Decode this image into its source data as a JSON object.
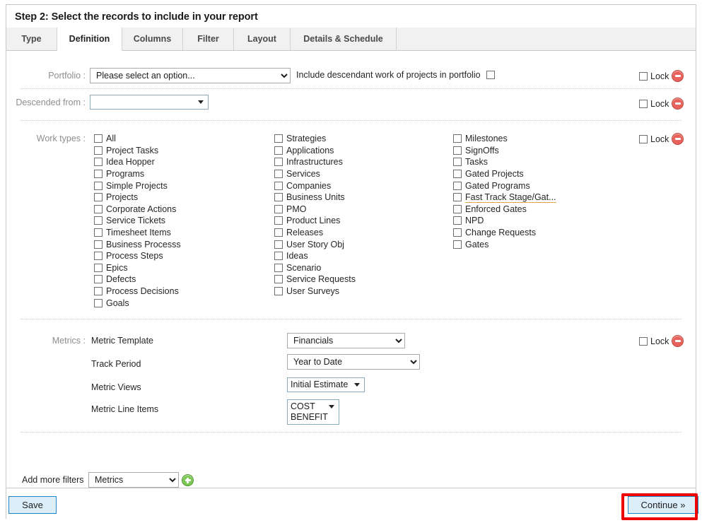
{
  "window": {
    "title": "Step 2: Select the records to include in your report"
  },
  "tabs": [
    {
      "label": "Type",
      "active": false
    },
    {
      "label": "Definition",
      "active": true
    },
    {
      "label": "Columns",
      "active": false
    },
    {
      "label": "Filter",
      "active": false
    },
    {
      "label": "Layout",
      "active": false
    },
    {
      "label": "Details & Schedule",
      "active": false
    }
  ],
  "portfolio": {
    "label": "Portfolio :",
    "select_value": "Please select an option...",
    "options": [
      "Please select an option..."
    ],
    "include_descendant_label": "Include descendant work of projects in portfolio",
    "include_descendant_checked": false,
    "lock_label": "Lock",
    "lock_checked": false,
    "remove_icon": "remove-circle-icon"
  },
  "descended_from": {
    "label": "Descended from :",
    "value": "",
    "lock_label": "Lock",
    "lock_checked": false,
    "remove_icon": "remove-circle-icon"
  },
  "work_types": {
    "label": "Work types :",
    "lock_label": "Lock",
    "lock_checked": false,
    "remove_icon": "remove-circle-icon",
    "columns": [
      {
        "items": [
          {
            "label": "All",
            "checked": false
          },
          {
            "label": "Project Tasks",
            "checked": false
          },
          {
            "label": "Idea Hopper",
            "checked": false
          },
          {
            "label": "Programs",
            "checked": false
          },
          {
            "label": "Simple Projects",
            "checked": false
          },
          {
            "label": "Projects",
            "checked": false
          },
          {
            "label": "Corporate Actions",
            "checked": false
          },
          {
            "label": "Service Tickets",
            "checked": false
          },
          {
            "label": "Timesheet Items",
            "checked": false
          },
          {
            "label": "Business Processs",
            "checked": false
          },
          {
            "label": "Process Steps",
            "checked": false
          },
          {
            "label": "Epics",
            "checked": false
          },
          {
            "label": "Defects",
            "checked": false
          },
          {
            "label": "Process Decisions",
            "checked": false
          },
          {
            "label": "Goals",
            "checked": false
          }
        ]
      },
      {
        "items": [
          {
            "label": "Strategies",
            "checked": false
          },
          {
            "label": "Applications",
            "checked": false
          },
          {
            "label": "Infrastructures",
            "checked": false
          },
          {
            "label": "Services",
            "checked": false
          },
          {
            "label": "Companies",
            "checked": false
          },
          {
            "label": "Business Units",
            "checked": false
          },
          {
            "label": "PMO",
            "checked": false
          },
          {
            "label": "Product Lines",
            "checked": false
          },
          {
            "label": "Releases",
            "checked": false
          },
          {
            "label": "User Story Obj",
            "checked": false
          },
          {
            "label": "Ideas",
            "checked": false
          },
          {
            "label": "Scenario",
            "checked": false
          },
          {
            "label": "Service Requests",
            "checked": false
          },
          {
            "label": "User Surveys",
            "checked": false
          }
        ]
      },
      {
        "items": [
          {
            "label": "Milestones",
            "checked": false
          },
          {
            "label": "SignOffs",
            "checked": false
          },
          {
            "label": "Tasks",
            "checked": false
          },
          {
            "label": "Gated Projects",
            "checked": false
          },
          {
            "label": "Gated Programs",
            "checked": false
          },
          {
            "label": "Fast Track Stage/Gat...",
            "checked": false,
            "truncated": true
          },
          {
            "label": "Enforced Gates",
            "checked": false
          },
          {
            "label": "NPD",
            "checked": false
          },
          {
            "label": "Change Requests",
            "checked": false
          },
          {
            "label": "Gates",
            "checked": false
          }
        ]
      }
    ]
  },
  "metrics": {
    "label": "Metrics :",
    "lock_label": "Lock",
    "lock_checked": false,
    "remove_icon": "remove-circle-icon",
    "rows": [
      {
        "label": "Metric Template",
        "value": "Financials",
        "control": "select"
      },
      {
        "label": "Track Period",
        "value": "Year to Date",
        "control": "select"
      },
      {
        "label": "Metric Views",
        "value": "Initial Estimate",
        "control": "combo"
      },
      {
        "label": "Metric Line Items",
        "value": "COST\nBENEFIT",
        "control": "combo-multi"
      }
    ],
    "metric_template_options": [
      "Financials"
    ],
    "track_period_options": [
      "Year to Date"
    ]
  },
  "add_filters": {
    "label": "Add more filters",
    "select_value": "Metrics",
    "options": [
      "Metrics"
    ],
    "add_icon": "add-circle-icon"
  },
  "footer": {
    "save_label": "Save",
    "continue_label": "Continue »"
  },
  "colors": {
    "accent_blue": "#1f87c6",
    "button_fill": "#ddeefb",
    "remove_red": "#e8635c",
    "add_green": "#7dc756",
    "highlight_red": "#ee0000",
    "truncate_underline": "#e0a44a",
    "label_gray": "#8e8e8e",
    "tab_bg": "#f1f1f1"
  }
}
